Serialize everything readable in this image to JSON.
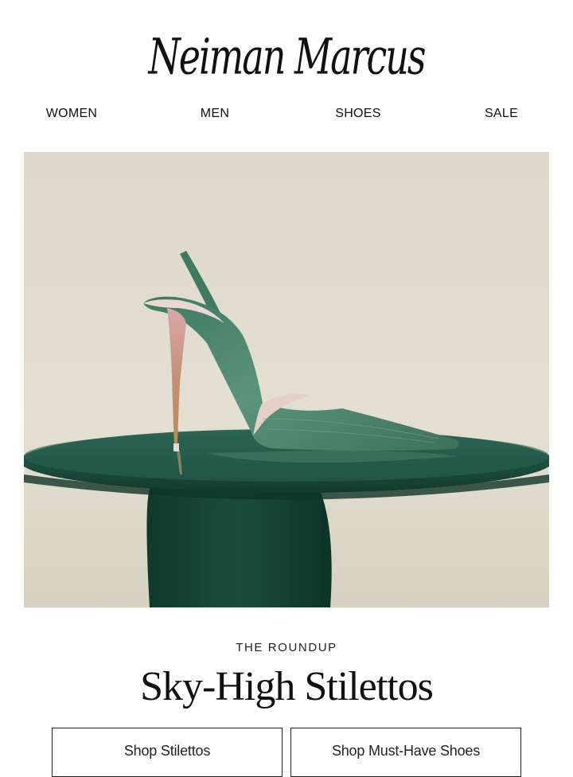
{
  "brand": {
    "logo_text": "Neiman Marcus"
  },
  "nav": {
    "items": [
      {
        "label": "WOMEN"
      },
      {
        "label": "MEN"
      },
      {
        "label": "SHOES"
      },
      {
        "label": "SALE"
      }
    ]
  },
  "hero": {
    "image_icon": "green-slingback-stiletto-photo"
  },
  "section": {
    "eyebrow": "THE ROUNDUP",
    "headline": "Sky-High Stilettos"
  },
  "buttons": {
    "left_label": "Shop Stilettos",
    "right_label": "Shop Must-Have Shoes"
  },
  "colors": {
    "background": "#ffffff",
    "hero_backdrop": "#ddd8ca",
    "table_green": "#1d4d3c",
    "shoe_green": "#4f8a70",
    "text": "#111111"
  }
}
